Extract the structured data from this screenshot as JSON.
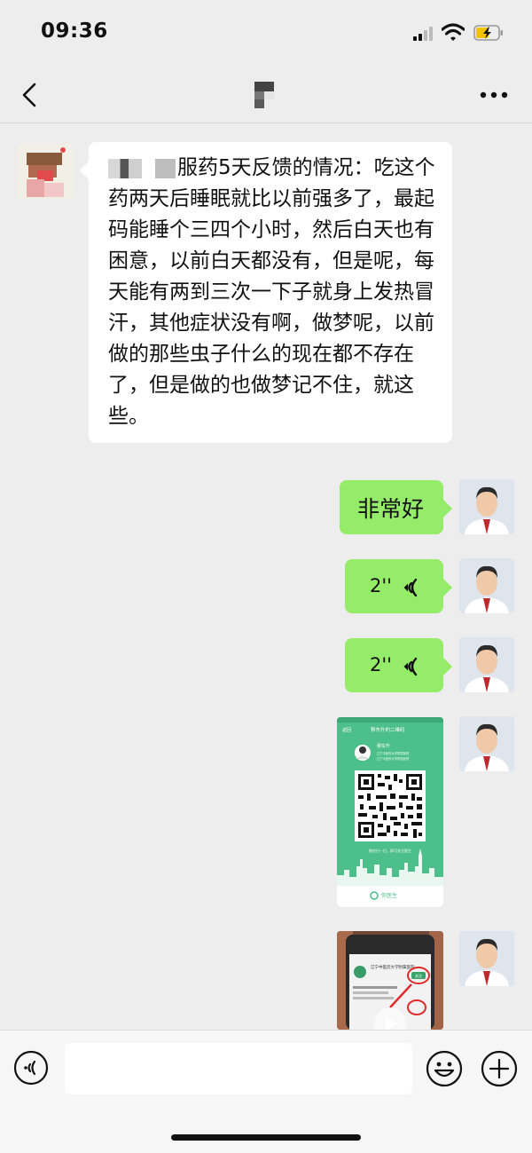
{
  "status_bar": {
    "time": "09:36"
  },
  "messages": {
    "incoming_text": "服药5天反馈的情况：吃这个药两天后睡眠就比以前强多了，最起码能睡个三四个小时，然后白天也有困意，以前白天都没有，但是呢，每天能有两到三次一下子就身上发热冒汗，其他症状没有啊，做梦呢，以前做的那些虫子什么的现在都不存在了，但是做的也做梦记不住，就这些。",
    "reply_text": "非常好",
    "voice_1_duration": "2''",
    "voice_2_duration": "2''",
    "qr_card": {
      "back_label": "返回",
      "title": "穆东升的二维码",
      "doctor_name": "穆东升",
      "link_1": "辽宁中医药大学附属医院",
      "link_2": "辽宁中医药大学附属医院",
      "scan_hint": "微信扫一扫，即可关注医生",
      "brand": "你医生"
    },
    "video_thumb": {
      "hospital_name": "辽宁中医药大学附属医院",
      "follow_label": "关注"
    }
  },
  "input": {
    "placeholder": ""
  },
  "colors": {
    "background": "#ededed",
    "outgoing_bubble": "#95ec69",
    "incoming_bubble": "#ffffff",
    "qr_green": "#4dbf8a"
  },
  "icons": [
    "back-icon",
    "more-icon",
    "voice-toggle-icon",
    "emoji-icon",
    "plus-icon",
    "voice-playback-icon"
  ]
}
